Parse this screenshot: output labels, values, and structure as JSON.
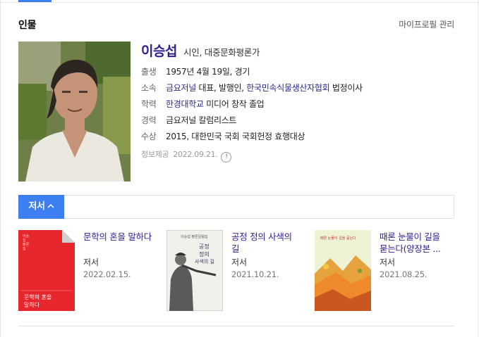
{
  "header": {
    "section_title": "인물",
    "manage_link": "마이프로필 관리"
  },
  "person": {
    "name": "이승섭",
    "job": "시인, 대중문화평론가",
    "info": [
      {
        "key": "출생",
        "value": "1957년 4월 19일, 경기"
      },
      {
        "key": "소속",
        "link1": "금요저널",
        "text1": " 대표, 발행인, ",
        "link2": "한국민속식물생산자협회",
        "text2": " 법정이사"
      },
      {
        "key": "학력",
        "link1": "한경대학교",
        "text1": " 미디어 창작 졸업"
      },
      {
        "key": "경력",
        "value": "금요저널 칼럼리스트"
      },
      {
        "key": "수상",
        "value": "2015, 대한민국 국회 국회헌정 효행대상"
      }
    ],
    "source_label": "정보제공",
    "source_date": "2022.09.21.",
    "info_icon": "!"
  },
  "tabs": {
    "active_label": "저서",
    "active_icon": "chevron-up-icon"
  },
  "books": [
    {
      "title": "문학의 혼을 말하다",
      "role": "저서",
      "date": "2022.02.15.",
      "cover": {
        "color": "#e8262d",
        "side_text": "이승섭 평론집",
        "cover_title_1": "문학의 혼을",
        "cover_title_2": "말하다"
      }
    },
    {
      "title": "공정 정의 사색의 길",
      "role": "저서",
      "date": "2021.10.21.",
      "cover": {
        "color": "#f2f0ea",
        "top_text": "이승섭 평론칼럼집",
        "title_lines": [
          "공정",
          "정의",
          "사색의 길"
        ]
      }
    },
    {
      "title": "때론 눈물이 길을 묻는다(양장본 ...",
      "role": "저서",
      "date": "2021.08.25.",
      "cover": {
        "color": "#ee8a2b",
        "top_text": "때론 눈물이 길을 묻는다"
      }
    }
  ],
  "colors": {
    "accent": "#3d7ff0",
    "name_link": "#2c1e92",
    "text": "#222222",
    "muted": "#999999"
  }
}
